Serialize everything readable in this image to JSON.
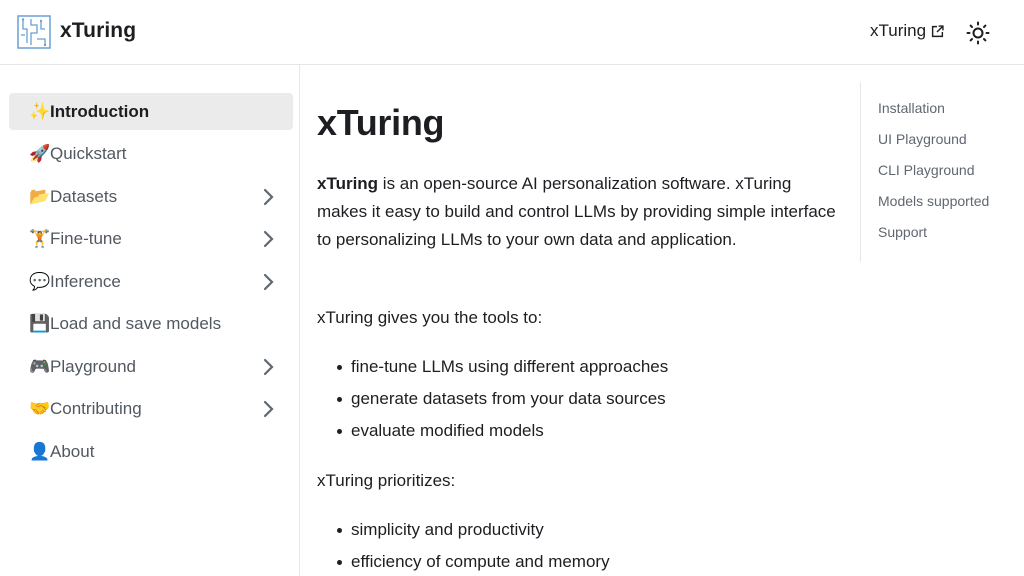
{
  "navbar": {
    "brand": "xTuring",
    "external_link": "xTuring"
  },
  "sidebar": {
    "items": [
      {
        "emoji": "✨",
        "label": "Introduction",
        "active": true,
        "expandable": false
      },
      {
        "emoji": "🚀",
        "label": "Quickstart",
        "active": false,
        "expandable": false
      },
      {
        "emoji": "📂",
        "label": "Datasets",
        "active": false,
        "expandable": true
      },
      {
        "emoji": "🏋",
        "label": "Fine-tune",
        "active": false,
        "expandable": true
      },
      {
        "emoji": "💬",
        "label": "Inference",
        "active": false,
        "expandable": true
      },
      {
        "emoji": "💾",
        "label": "Load and save models",
        "active": false,
        "expandable": false
      },
      {
        "emoji": "🎮",
        "label": "Playground",
        "active": false,
        "expandable": true
      },
      {
        "emoji": "🤝",
        "label": "Contributing",
        "active": false,
        "expandable": true
      },
      {
        "emoji": "👤",
        "label": "About",
        "active": false,
        "expandable": false
      }
    ]
  },
  "main": {
    "title": "xTuring",
    "intro_bold": "xTuring",
    "intro_rest": " is an open-source AI personalization software. xTuring makes it easy to build and control LLMs by providing simple interface to personalizing LLMs to your own data and application.",
    "tools_intro": "xTuring gives you the tools to:",
    "tools": [
      "fine-tune LLMs using different approaches",
      "generate datasets from your data sources",
      "evaluate modified models"
    ],
    "priorities_intro": "xTuring prioritizes:",
    "priorities": [
      "simplicity and productivity",
      "efficiency of compute and memory"
    ]
  },
  "toc": {
    "items": [
      "Installation",
      "UI Playground",
      "CLI Playground",
      "Models supported",
      "Support"
    ]
  },
  "colors": {
    "text": "#1c1e21",
    "sidebar_text": "#525860",
    "active_bg": "#ebebeb",
    "toc_text": "#606770",
    "border": "#e6e6e6"
  }
}
